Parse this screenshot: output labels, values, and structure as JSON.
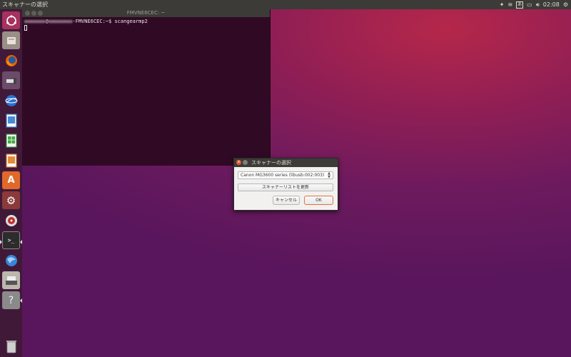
{
  "top_panel": {
    "title": "スキャナーの選択",
    "ime": "あ",
    "clock": "02:08"
  },
  "terminal": {
    "title": "FMVNE6CEC: ~",
    "user_blurred": "■■■■■■■",
    "host_blurred": "■■■■■■■■",
    "prompt_host": "-FMVNE6CEC:~$",
    "command": "scangearmp2"
  },
  "dialog": {
    "title": "スキャナーの選択",
    "selected_scanner": "Canon MG3600 series (libusb:002:003)",
    "refresh_label": "スキャナーリストを更新",
    "cancel_label": "キャンセル",
    "ok_label": "OK"
  },
  "launcher": {
    "icons": [
      "dash-home-icon",
      "files-icon",
      "firefox-icon",
      "system-tool-icon",
      "browser-icon",
      "writer-icon",
      "calc-icon",
      "impress-icon",
      "software-center-icon",
      "system-settings-icon",
      "disk-utility-icon",
      "terminal-icon",
      "web-icon",
      "scanner-icon",
      "help-icon",
      "trash-icon"
    ]
  },
  "colors": {
    "panel": "#3c3b37",
    "terminal_bg": "#300a24",
    "accent": "#e9703b"
  }
}
